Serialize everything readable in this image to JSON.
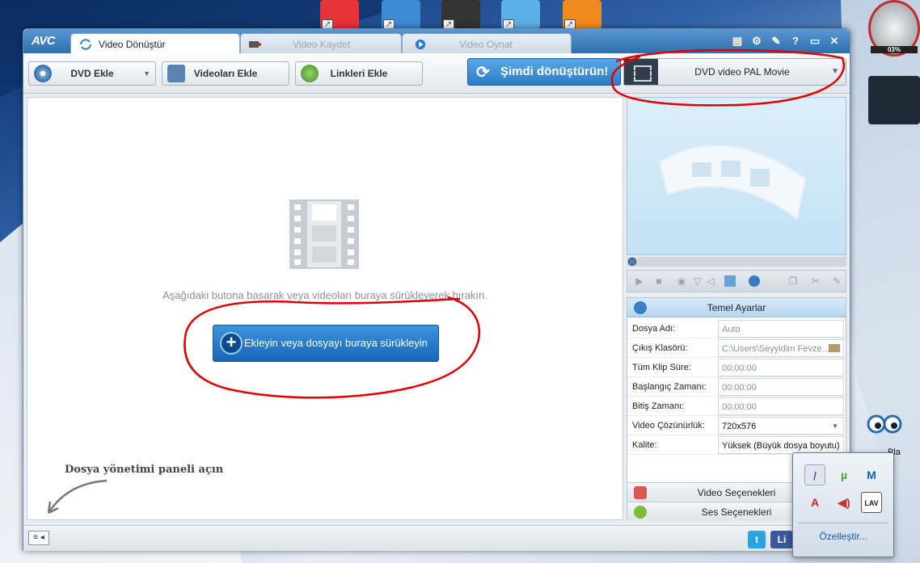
{
  "window": {
    "logo": "AVC",
    "tabs": [
      {
        "label": "Video Dönüştür"
      },
      {
        "label": "Video Kaydet"
      },
      {
        "label": "Video Oynat"
      }
    ]
  },
  "toolbar": {
    "dvd_label": "DVD Ekle",
    "videos_label": "Videoları Ekle",
    "links_label": "Linkleri Ekle",
    "convert_label": "Şimdi dönüştürün!",
    "profile_label": "DVD video PAL Movie"
  },
  "drop_area": {
    "hint": "Aşağıdaki butona basarak veya videoları buraya sürükleyerek bırakın.",
    "add_button": "Ekleyin veya dosyayı buraya sürükleyin",
    "manager_label": "Dosya yönetimi paneli açın"
  },
  "settings": {
    "header": "Temel Ayarlar",
    "rows": [
      {
        "label": "Dosya Adı:",
        "value": "Auto"
      },
      {
        "label": "Çıkış Klasörü:",
        "value": "C:\\Users\\Seyyidim Fevze..."
      },
      {
        "label": "Tüm Klip Süre:",
        "value": "00:00:00"
      },
      {
        "label": "Başlangıç Zamanı:",
        "value": "00:00:00"
      },
      {
        "label": "Bitiş Zamanı:",
        "value": "00:00:00"
      },
      {
        "label": "Video Çözünürlük:",
        "value": "720x576"
      },
      {
        "label": "Kalite:",
        "value": "Yüksek (Büyük dosya boyutu)"
      }
    ],
    "video_options": "Video Seçenekleri",
    "audio_options": "Ses Seçenekleri"
  },
  "status": {
    "toggle": "≡ ◂",
    "facebook_partial": "Li"
  },
  "tray": {
    "customize": "Özelleştir..."
  },
  "desktop": {
    "gauge_text": "03%",
    "icon_label_partial": "Pla"
  },
  "colors": {
    "accent": "#2c7cc6",
    "annotation": "#e00000"
  }
}
